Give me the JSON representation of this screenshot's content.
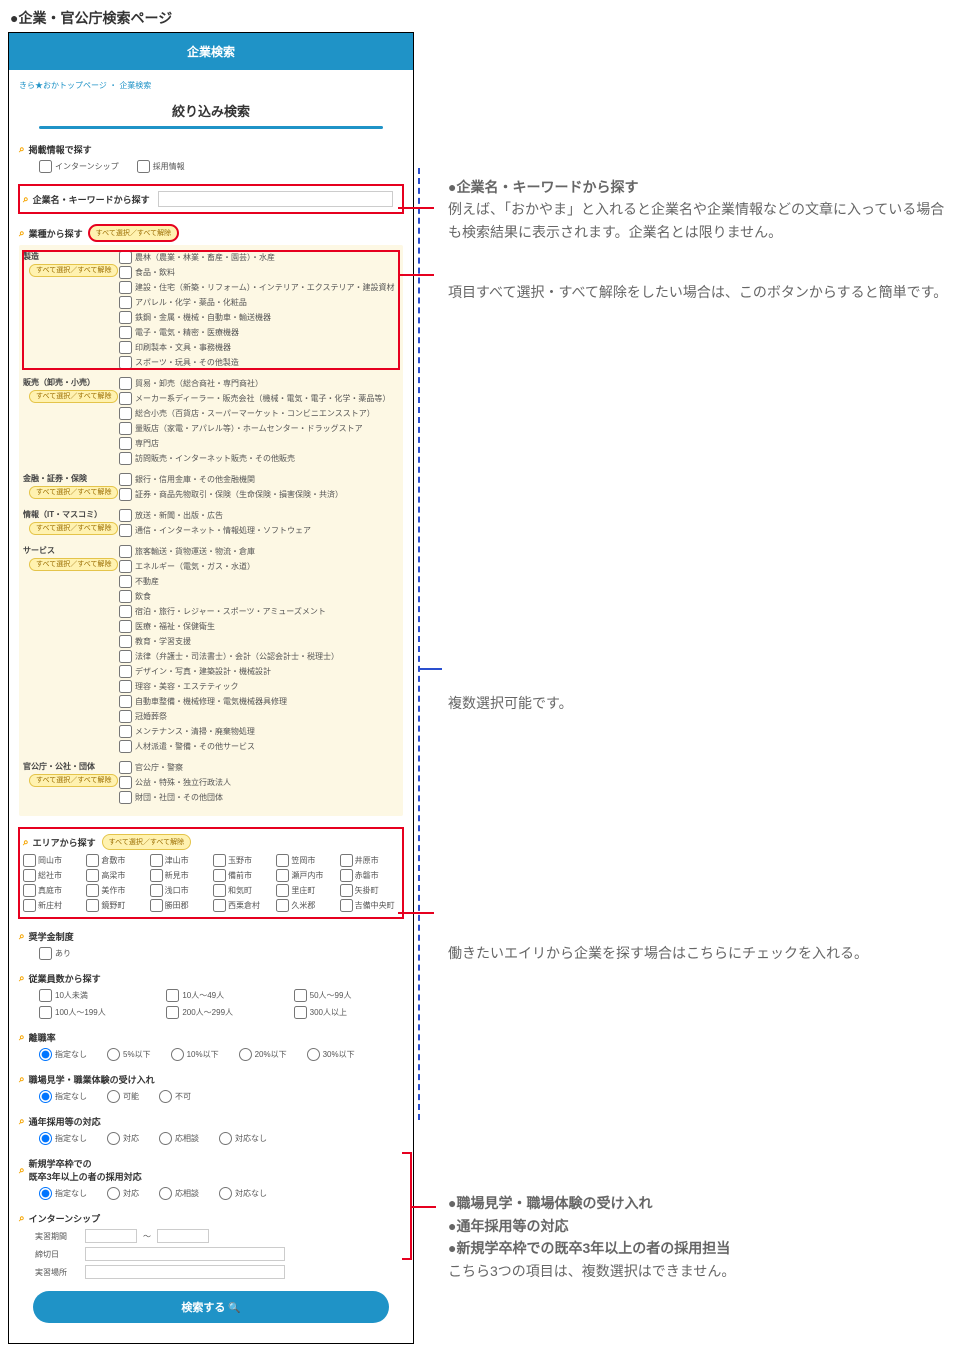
{
  "page_title_prefix": "●",
  "page_title": "企業・官公庁検索ページ",
  "app": {
    "header": "企業検索",
    "breadcrumb_link": "きら★おかトップページ",
    "breadcrumb_sep": " ・ ",
    "breadcrumb_current": "企業検索",
    "refine_title": "絞り込み検索",
    "submit": "検索する"
  },
  "sections": {
    "posting": {
      "label": "掲載情報で探す",
      "opts": [
        "インターンシップ",
        "採用情報"
      ]
    },
    "keyword": {
      "label": "企業名・キーワードから探す"
    },
    "industry": {
      "label": "業種から探す",
      "toggle": "すべて選択／すべて解除",
      "groups": [
        {
          "name": "製造",
          "items": [
            "農林（農業・林業・畜産・園芸）・水産",
            "食品・飲料",
            "建設・住宅（新築・リフォーム）・インテリア・エクステリア・建設資材",
            "アパレル・化学・薬品・化粧品",
            "鉄鋼・金属・機械・自動車・輸送機器",
            "電子・電気・精密・医療機器",
            "印刷製本・文具・事務機器",
            "スポーツ・玩具・その他製造"
          ]
        },
        {
          "name": "販売（卸売・小売）",
          "items": [
            "貿易・卸売（総合商社・専門商社）",
            "メーカー系ディーラー・販売会社（機械・電気・電子・化学・薬品等）",
            "総合小売（百貨店・スーパーマーケット・コンビニエンスストア）",
            "量販店（家電・アパレル等）・ホームセンター・ドラッグストア",
            "専門店",
            "訪問販売・インターネット販売・その他販売"
          ]
        },
        {
          "name": "金融・証券・保険",
          "items": [
            "銀行・信用金庫・その他金融機関",
            "証券・商品先物取引・保険（生命保険・損害保険・共済）"
          ]
        },
        {
          "name": "情報（IT・マスコミ）",
          "items": [
            "放送・新聞・出版・広告",
            "通信・インターネット・情報処理・ソフトウェア"
          ]
        },
        {
          "name": "サービス",
          "items": [
            "旅客輸送・貨物運送・物流・倉庫",
            "エネルギー（電気・ガス・水道）",
            "不動産",
            "飲食",
            "宿泊・旅行・レジャー・スポーツ・アミューズメント",
            "医療・福祉・保健衛生",
            "教育・学習支援",
            "法律（弁護士・司法書士）・会計（公認会計士・税理士）",
            "デザイン・写真・建築設計・機械設計",
            "理容・美容・エステティック",
            "自動車整備・機械修理・電気機械器具修理",
            "冠婚葬祭",
            "メンテナンス・清掃・廃棄物処理",
            "人材派遣・警備・その他サービス"
          ]
        },
        {
          "name": "官公庁・公社・団体",
          "items": [
            "官公庁・警察",
            "公益・特殊・独立行政法人",
            "財団・社団・その他団体"
          ]
        }
      ]
    },
    "area": {
      "label": "エリアから探す",
      "toggle": "すべて選択／すべて解除",
      "items": [
        "岡山市",
        "倉敷市",
        "津山市",
        "玉野市",
        "笠岡市",
        "井原市",
        "総社市",
        "高梁市",
        "新見市",
        "備前市",
        "瀬戸内市",
        "赤磐市",
        "真庭市",
        "美作市",
        "浅口市",
        "和気町",
        "里庄町",
        "矢掛町",
        "新庄村",
        "鏡野町",
        "勝田郡",
        "西栗倉村",
        "久米郡",
        "吉備中央町"
      ]
    },
    "scholarship": {
      "label": "奨学金制度",
      "opts": [
        "あり"
      ]
    },
    "employees": {
      "label": "従業員数から探す",
      "opts": [
        "10人未満",
        "10人～49人",
        "50人～99人",
        "100人～199人",
        "200人～299人",
        "300人以上"
      ]
    },
    "turnover": {
      "label": "離職率",
      "opts": [
        "指定なし",
        "5%以下",
        "10%以下",
        "20%以下",
        "30%以下"
      ]
    },
    "visit": {
      "label": "職場見学・職業体験の受け入れ",
      "opts": [
        "指定なし",
        "可能",
        "不可"
      ]
    },
    "yearround": {
      "label": "通年採用等の対応",
      "opts": [
        "指定なし",
        "対応",
        "応相談",
        "対応なし"
      ]
    },
    "grad3": {
      "label_line1": "新規学卒枠での",
      "label_line2": "既卒3年以上の者の採用対応",
      "opts": [
        "指定なし",
        "対応",
        "応相談",
        "対応なし"
      ]
    },
    "intern": {
      "label": "インターンシップ",
      "period": "実習期間",
      "period_sep": "～",
      "deadline": "締切日",
      "place": "実習場所"
    }
  },
  "annotations": {
    "kw_title": "●企業名・キーワードから探す",
    "kw_body": "例えば、「おかやま」と入れると企業名や企業情報などの文章に入っている場合も検索結果に表示されます。企業名とは限りません。",
    "toggle_body": "項目すべて選択・すべて解除をしたい場合は、このボタンからすると簡単です。",
    "multi": "複数選択可能です。",
    "area_body": "働きたいエイリから企業を探す場合はこちらにチェックを入れる。",
    "r1": "●職場見学・職場体験の受け入れ",
    "r2": "●通年採用等の対応",
    "r3": "●新規学卒枠での既卒3年以上の者の採用担当",
    "r_note": "こちら3つの項目は、複数選択はできません。"
  }
}
